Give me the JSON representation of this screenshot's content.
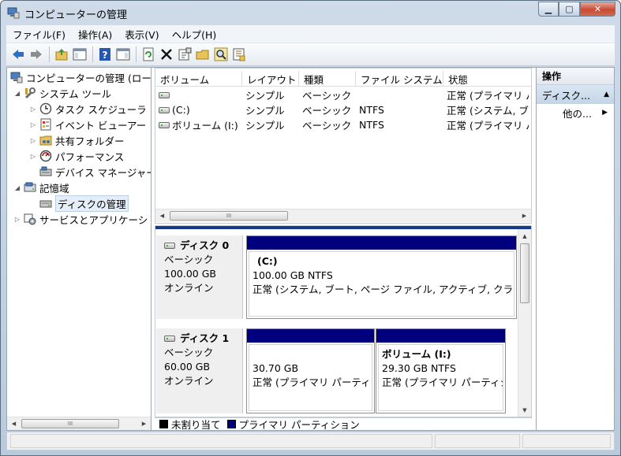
{
  "window": {
    "title": "コンピューターの管理"
  },
  "menu": [
    "ファイル(F)",
    "操作(A)",
    "表示(V)",
    "ヘルプ(H)"
  ],
  "toolbar_icons": [
    "back-icon",
    "forward-icon",
    "up-folder-icon",
    "show-hide-tree-icon",
    "help-icon",
    "show-hide-action-icon",
    "refresh-icon",
    "delete-icon",
    "properties-icon",
    "open-icon",
    "search-icon",
    "export-icon"
  ],
  "tree": {
    "root": "コンピューターの管理 (ロー",
    "system_tools": "システム ツール",
    "task_scheduler": "タスク スケジューラ",
    "event_viewer": "イベント ビューアー",
    "shared_folders": "共有フォルダー",
    "performance": "パフォーマンス",
    "device_manager": "デバイス マネージャー",
    "storage": "記憶域",
    "disk_management": "ディスクの管理",
    "services_apps": "サービスとアプリケーシ"
  },
  "volume_list": {
    "columns": [
      "ボリューム",
      "レイアウト",
      "種類",
      "ファイル システム",
      "状態"
    ],
    "rows": [
      {
        "volume": "",
        "layout": "シンプル",
        "type": "ベーシック",
        "fs": "",
        "status": "正常 (プライマリ パ"
      },
      {
        "volume": "(C:)",
        "layout": "シンプル",
        "type": "ベーシック",
        "fs": "NTFS",
        "status": "正常 (システム, ブー"
      },
      {
        "volume": "ボリューム (I:)",
        "layout": "シンプル",
        "type": "ベーシック",
        "fs": "NTFS",
        "status": "正常 (プライマリ パ"
      }
    ]
  },
  "disks": [
    {
      "name": "ディスク 0",
      "kind": "ベーシック",
      "size": "100.00 GB",
      "state": "オンライン",
      "partitions": [
        {
          "title": "(C:)",
          "size": "100.00 GB NTFS",
          "status": "正常 (システム, ブート, ページ ファイル, アクティブ, クラッ"
        }
      ]
    },
    {
      "name": "ディスク 1",
      "kind": "ベーシック",
      "size": "60.00 GB",
      "state": "オンライン",
      "partitions": [
        {
          "title": "",
          "size": "30.70 GB",
          "status": "正常 (プライマリ パーティシ"
        },
        {
          "title": "ボリューム (I:)",
          "size": "29.30 GB NTFS",
          "status": "正常 (プライマリ パーティシ"
        }
      ]
    }
  ],
  "legend": {
    "unallocated": "未割り当て",
    "primary": "プライマリ パーティション",
    "unallocated_color": "#000000",
    "primary_color": "#00007f"
  },
  "actions": {
    "header": "操作",
    "selected": "ディスク...",
    "other": "他の..."
  },
  "scroll_thumb_grip": "III"
}
